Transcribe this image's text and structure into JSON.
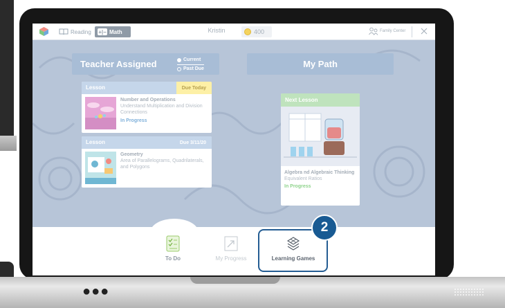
{
  "app_bar": {
    "tab_reading": "Reading",
    "tab_math": "Math",
    "math_icon_glyph": "+|−",
    "user_name": "Kristin",
    "coins": "400",
    "family_center": "Family Center"
  },
  "assignments": {
    "title": "Teacher Assigned",
    "option_current": "Current",
    "option_past_due": "Past Due"
  },
  "path": {
    "title": "My Path"
  },
  "cards": [
    {
      "header": "Lesson",
      "due": "Due Today",
      "subject": "Number and Operations",
      "description": "Understand Multiplication and Division Connections",
      "status": "In Progress"
    },
    {
      "header": "Lesson",
      "due": "Due 3/11/20",
      "subject": "Geometry",
      "description": "Area of Parallelograms, Quadrilaterals, and Polygons",
      "status": ""
    }
  ],
  "next_lesson": {
    "header": "Next Lesson",
    "subject": "Algebra nd Algebraic Thinking",
    "description": "Equivalent Ratios",
    "status": "In Progress"
  },
  "bottom_nav": {
    "todo": "To Do",
    "progress": "My Progress",
    "games": "Learning Games"
  },
  "callout": {
    "step": "2"
  },
  "device": {
    "dots": "●●●"
  },
  "colors": {
    "screen_bg": "#b7c5d8",
    "header_blue": "#a8bdd6",
    "accent_dark_blue": "#185a93",
    "due_today_yellow": "#fdf0a6",
    "next_lesson_green": "#bfe3bd"
  },
  "icons": {
    "logo": "cube-logo-icon",
    "reading": "book-icon",
    "coin": "coin-icon",
    "family": "people-icon",
    "close": "close-icon",
    "todo": "checklist-icon",
    "progress": "arrow-chart-icon",
    "games": "stacked-diamonds-icon"
  }
}
